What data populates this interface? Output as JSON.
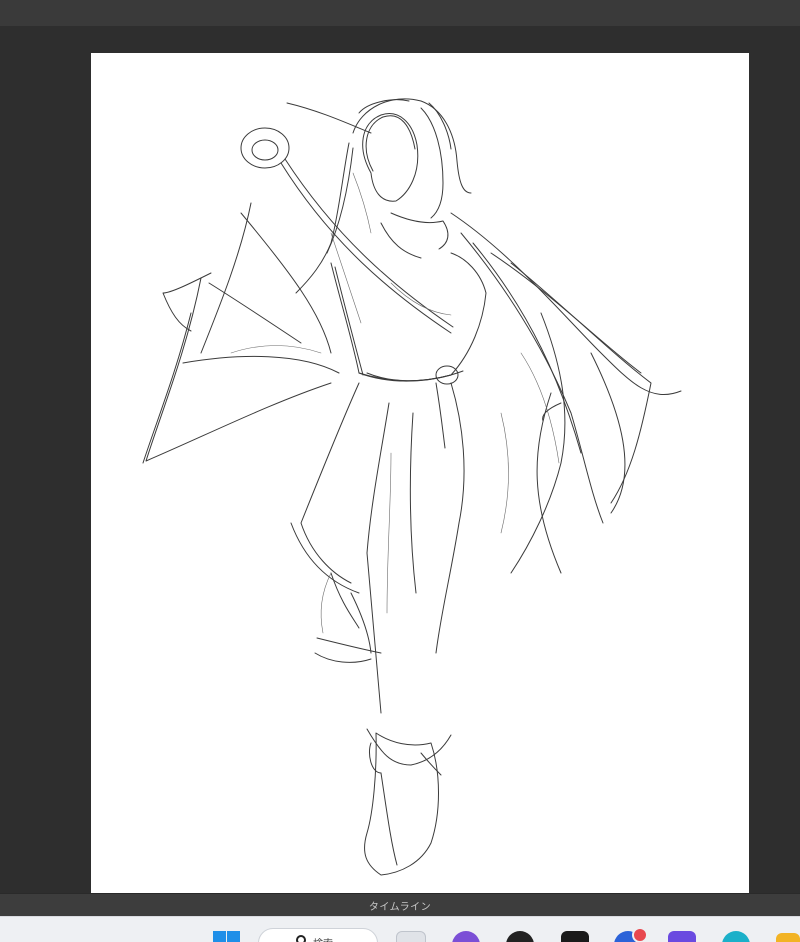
{
  "timeline": {
    "label": "タイムライン"
  },
  "taskbar": {
    "search_text": "検索",
    "apps": [
      {
        "icon": "file-explorer-icon",
        "color": "#e0e3e8"
      },
      {
        "icon": "app-purple-icon",
        "color": "#7b4fd6"
      },
      {
        "icon": "app-dark-icon",
        "color": "#222222"
      },
      {
        "icon": "clip-studio-icon",
        "color": "#1a1a1a"
      },
      {
        "icon": "app-notify-icon",
        "color": "#2b62d8",
        "badge_color": "#e8484f"
      },
      {
        "icon": "app-gradient-icon",
        "color": "#6a4ae0"
      },
      {
        "icon": "edge-icon",
        "color": "#1bb0c9"
      },
      {
        "icon": "folder-icon",
        "color": "#f2b324"
      }
    ]
  },
  "colors": {
    "workspace": "#2e2e2e",
    "canvas": "#ffffff",
    "timeline": "#3d3d3d",
    "taskbar": "#eef0f3",
    "accent": "#1f8fe8"
  }
}
